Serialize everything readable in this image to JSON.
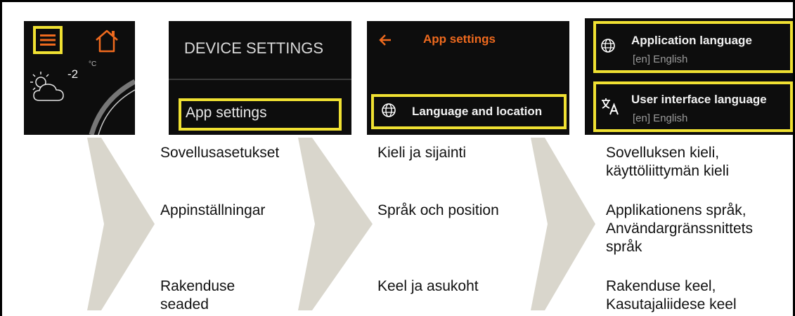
{
  "colors": {
    "accent": "#ef6a1e",
    "highlight": "#f0e132",
    "arrow": "#d9d6cc",
    "screen_bg": "#0d0d0d"
  },
  "step1": {
    "temperature": "-2",
    "temperature_unit": "°C",
    "icons": [
      "menu-icon",
      "home-icon",
      "partly-cloudy-icon"
    ]
  },
  "step2": {
    "header": "DEVICE SETTINGS",
    "selected": "App settings"
  },
  "step3": {
    "title": "App settings",
    "selected": "Language and location",
    "icons": [
      "back-arrow-icon",
      "globe-icon"
    ]
  },
  "step4": {
    "item1": {
      "label": "Application language",
      "value": "[en] English"
    },
    "item2": {
      "label": "User interface language",
      "value": "[en] English"
    },
    "icons": [
      "globe-icon",
      "translate-icon"
    ]
  },
  "captions": {
    "col2": {
      "fi": "Sovellusasetukset",
      "sv": "Appinställningar",
      "et_line1": "Rakenduse",
      "et_line2": "seaded"
    },
    "col3": {
      "fi": "Kieli ja sijainti",
      "sv": "Språk och position",
      "et": "Keel ja asukoht"
    },
    "col4": {
      "fi_line1": "Sovelluksen kieli,",
      "fi_line2": "käyttöliittymän kieli",
      "sv_line1": "Applikationens språk,",
      "sv_line2": "Användargränssnittets",
      "sv_line3": "språk",
      "et_line1": "Rakenduse keel,",
      "et_line2": "Kasutajaliidese keel"
    }
  }
}
